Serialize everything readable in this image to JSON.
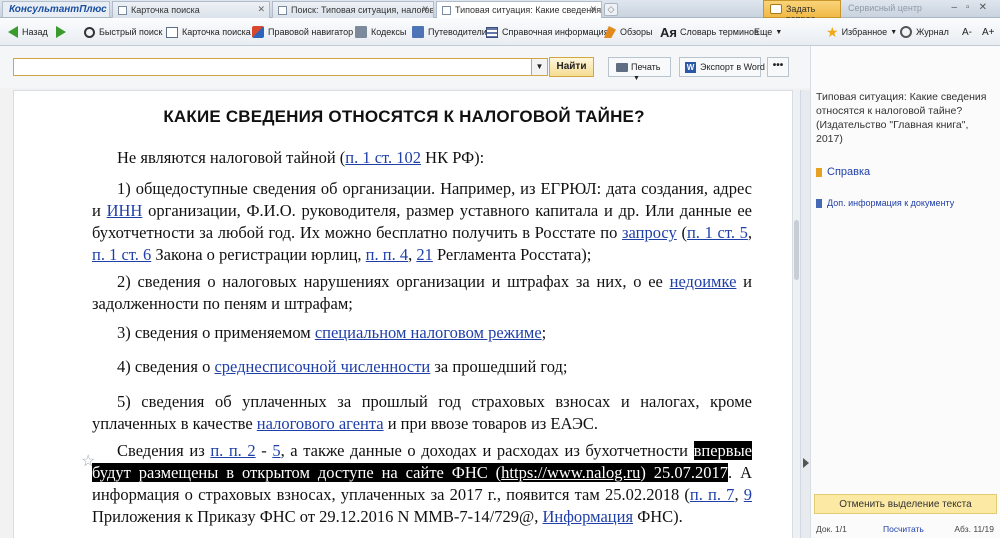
{
  "tabs": {
    "logo": "КонсультантПлюс",
    "items": [
      {
        "label": "Карточка поиска"
      },
      {
        "label": "Поиск: Типовая ситуация, налогова..."
      },
      {
        "label": "Типовая ситуация: Какие сведения ..."
      }
    ],
    "ask_button": "Задать вопрос",
    "service_center": "Сервисный центр"
  },
  "toolbar": {
    "back": "Назад",
    "quick_search": "Быстрый поиск",
    "search_card": "Карточка поиска",
    "legal_navigator": "Правовой навигатор",
    "codes": "Кодексы",
    "guides": "Путеводители",
    "reference_info": "Справочная информация",
    "reviews": "Обзоры",
    "dictionary": "Словарь терминов",
    "more": "Еще",
    "favorites": "Избранное",
    "journal": "Журнал",
    "font_down": "A-",
    "font_up": "A+"
  },
  "search": {
    "value": "",
    "find_button": "Найти",
    "print_button": "Печать",
    "export_button": "Экспорт в Word",
    "more_button": "•••"
  },
  "document": {
    "title": "КАКИЕ СВЕДЕНИЯ ОТНОСЯТСЯ К НАЛОГОВОЙ ТАЙНЕ?",
    "p1": {
      "t1": "Не являются налоговой тайной (",
      "l1": "п. 1 ст. 102",
      "t2": " НК РФ):"
    },
    "p2": {
      "t1": "1) общедоступные сведения об организации. Например, из ЕГРЮЛ: дата создания, адрес и ",
      "l1": "ИНН",
      "t2": " организации, Ф.И.О. руководителя, размер уставного капитала и др. Или данные ее бухотчетности за любой год. Их можно бесплатно получить в Росстате по ",
      "l2": "запросу",
      "t3": " (",
      "l3": "п. 1 ст. 5",
      "t4": ", ",
      "l4": "п. 1 ст. 6",
      "t5": " Закона о регистрации юрлиц, ",
      "l5": "п. п. 4",
      "t6": ", ",
      "l6": "21",
      "t7": " Регламента Росстата);"
    },
    "p3": {
      "t1": "2) сведения о налоговых нарушениях организации и штрафах за них, о ее ",
      "l1": "недоимке",
      "t2": " и задолженности по пеням и штрафам;"
    },
    "p4": {
      "t1": "3) сведения о применяемом ",
      "l1": "специальном налоговом режиме",
      "t2": ";"
    },
    "p5": {
      "t1": "4) сведения о ",
      "l1": "среднесписочной численности",
      "t2": " за прошедший год;"
    },
    "p6": {
      "t1": "5) сведения об уплаченных за прошлый год страховых взносах и налогах, кроме уплаченных в качестве ",
      "l1": "налогового агента",
      "t2": " и при ввозе товаров из ЕАЭС."
    },
    "p7": {
      "t1": "Сведения из ",
      "l1": "п. п. 2",
      "t2": " - ",
      "l2": "5",
      "t3": ", а также данные о доходах и расходах из бухотчетности ",
      "h1": "впервые будут размещены в открытом доступе на сайте ФНС (",
      "hl": "https://www.nalog.ru",
      "h2": ") 25.07.2017",
      "t4": ". А информация о страховых взносах, уплаченных за 2017 г., появится там 25.02.2018 (",
      "l3": "п. п. 7",
      "t5": ", ",
      "l4": "9",
      "t6": " Приложения к Приказу ФНС от 29.12.2016 N ММВ-7-14/729@, ",
      "l5": "Информация",
      "t7": " ФНС)."
    }
  },
  "side": {
    "doc_title": "Типовая ситуация: Какие сведения относятся к налоговой тайне? (Издательство \"Главная книга\", 2017)",
    "reference": "Справка",
    "extra_info": "Доп. информация к документу",
    "cancel_highlight": "Отменить выделение текста",
    "status_doc": "Док. 1/1",
    "status_count": "Посчитать",
    "status_para": "Абз. 11/19"
  },
  "colors": {
    "link": "#1f3fa8",
    "accent": "#f0b946",
    "highlight": "#000000"
  }
}
